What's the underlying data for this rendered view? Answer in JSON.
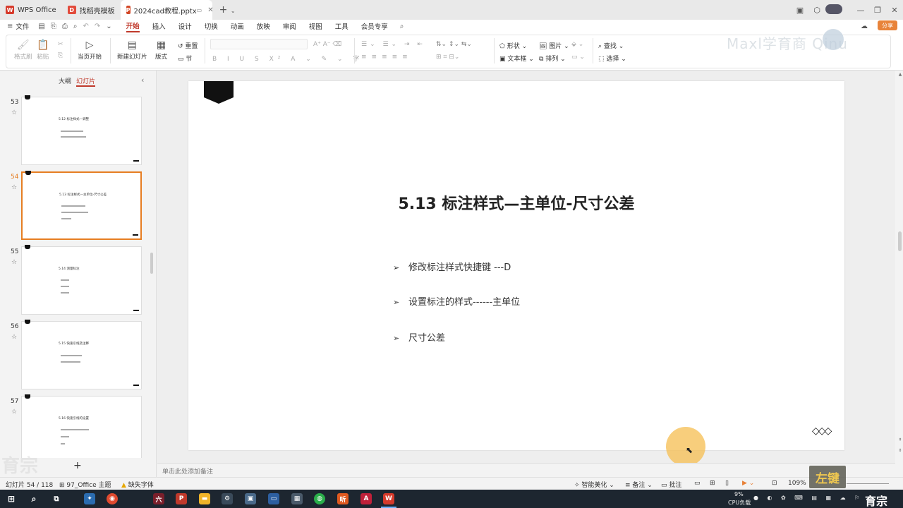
{
  "tabs": [
    {
      "label": "WPS Office",
      "icon": "wps-logo-icon"
    },
    {
      "label": "找稻壳模板",
      "icon": "docer-icon"
    },
    {
      "label": "2024cad教程.pptx",
      "icon": "ppt-file-icon"
    }
  ],
  "menu": {
    "file": "文件",
    "items": [
      "开始",
      "插入",
      "设计",
      "切换",
      "动画",
      "放映",
      "审阅",
      "视图",
      "工具",
      "会员专享"
    ],
    "active": "开始",
    "share": "分享"
  },
  "ribbon": {
    "format_painter": "格式刷",
    "paste": "粘贴",
    "start_from_current": "当页开始",
    "new_slide": "新建幻灯片",
    "layout": "版式",
    "reset": "重置",
    "section": "节",
    "shape": "形状",
    "picture": "图片",
    "textbox": "文本框",
    "arrange": "排列",
    "find": "查找",
    "select": "选择"
  },
  "watermark": "Maxl学育商 Qinu",
  "panel": {
    "tab_outline": "大纲",
    "tab_slides": "幻灯片",
    "add": "+"
  },
  "slides_panel": [
    {
      "num": "53",
      "title": "5.12 标注样式—调整"
    },
    {
      "num": "54",
      "title": "5.13 标注样式—主单位-尺寸公差",
      "selected": true
    },
    {
      "num": "55",
      "title": "5.14 测量标注"
    },
    {
      "num": "56",
      "title": "5.15 快速引线及注释"
    },
    {
      "num": "57",
      "title": "5.16 快速引线的设置"
    }
  ],
  "slide": {
    "title": "5.13  标注样式—主单位-尺寸公差",
    "bullets": [
      "修改标注样式快捷键 ---D",
      "设置标注的样式------主单位",
      "尺寸公差"
    ],
    "bullet_symbol": "➢",
    "decoration": "◇◇◇"
  },
  "notes_placeholder": "单击此处添加备注",
  "status": {
    "slide_count": "幻灯片 54 / 118",
    "theme": "97_Office 主题",
    "missing_font": "缺失字体",
    "smart_beautify": "智能美化",
    "notes": "备注",
    "comments": "批注",
    "zoom": "109%"
  },
  "left_key_overlay": "左键",
  "taskbar": {
    "cpu_percent": "9%",
    "cpu_label": "CPU负载",
    "brand": "育宗"
  },
  "colors": {
    "accent": "#c0392b",
    "selected_thumb_border": "#e67e22",
    "taskbar_bg": "#1d2630"
  }
}
